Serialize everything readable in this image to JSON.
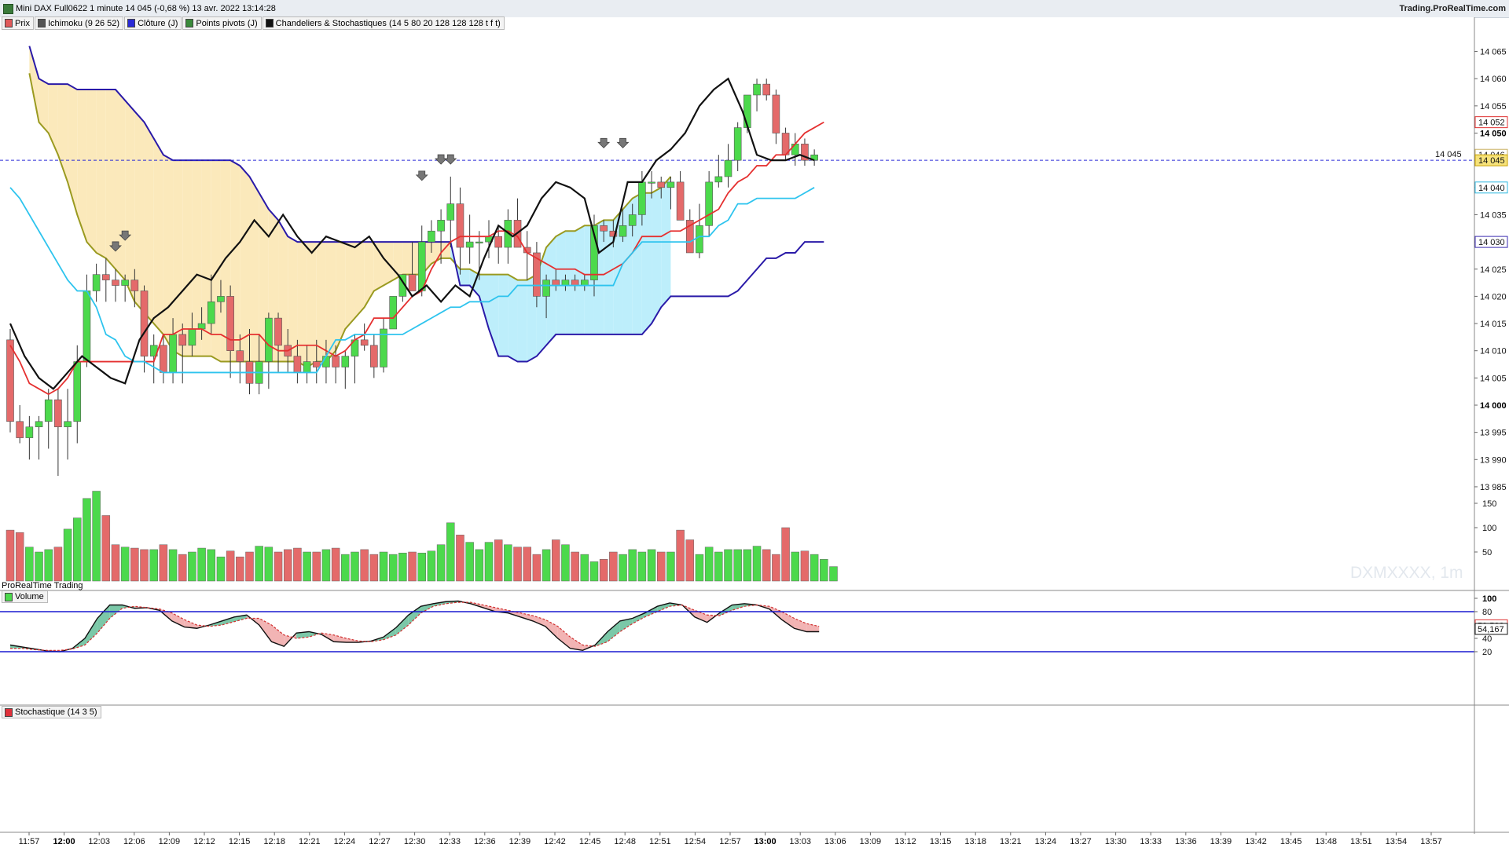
{
  "window": {
    "title": "Mini DAX Full0622 1 minute 14 045 (-0,68 %) 13 avr. 2022 13:14:28",
    "brand": "Trading.ProRealTime.com"
  },
  "legend": [
    {
      "label": "Prix",
      "color": "#e05a5a"
    },
    {
      "label": "Ichimoku (9 26 52)",
      "color": "#555555"
    },
    {
      "label": "Clôture (J)",
      "color": "#2a2ad6"
    },
    {
      "label": "Points pivots (J)",
      "color": "#3a8a3a"
    },
    {
      "label": "Chandeliers & Stochastiques (14 5 80 20 128 128 128 t f t)",
      "color": "#111111"
    }
  ],
  "panels": {
    "volume_label": "Volume",
    "stoch_label": "Stochastique (14 3 5)",
    "source_label": "ProRealTime Trading",
    "watermark": "DXMXXXX, 1m"
  },
  "price_axis": {
    "ticks": [
      "14 065",
      "14 060",
      "14 055",
      "14 050",
      "14 045",
      "14 040",
      "14 035",
      "14 030",
      "14 025",
      "14 020",
      "14 015",
      "14 010",
      "14 005",
      "14 000",
      "13 995",
      "13 990",
      "13 985"
    ],
    "bold_ticks": [
      "14 050",
      "14 000"
    ],
    "current_line_label": "14 045",
    "markers": [
      {
        "text": "14 052",
        "color": "#e03030"
      },
      {
        "text": "14 046",
        "color": "#c8b060"
      },
      {
        "text": "14 045",
        "color": "#c8a000"
      },
      {
        "text": "14 040",
        "color": "#2fb8e0"
      },
      {
        "text": "14 030",
        "color": "#3a2ab0"
      }
    ]
  },
  "volume_axis": {
    "ticks": [
      "150",
      "100",
      "50"
    ]
  },
  "stoch_axis": {
    "ticks": [
      "100",
      "80",
      "60",
      "40",
      "20"
    ],
    "markers": [
      {
        "text": "59,583",
        "color": "#e03030"
      },
      {
        "text": "54,167",
        "color": "#111111"
      }
    ]
  },
  "time_axis": [
    "11:57",
    "12:00",
    "12:03",
    "12:06",
    "12:09",
    "12:12",
    "12:15",
    "12:18",
    "12:21",
    "12:24",
    "12:27",
    "12:30",
    "12:33",
    "12:36",
    "12:39",
    "12:42",
    "12:45",
    "12:48",
    "12:51",
    "12:54",
    "12:57",
    "13:00",
    "13:03",
    "13:06",
    "13:09",
    "13:12",
    "13:15",
    "13:18",
    "13:21",
    "13:24",
    "13:27",
    "13:30",
    "13:33",
    "13:36",
    "13:39",
    "13:42",
    "13:45",
    "13:48",
    "13:51",
    "13:54",
    "13:57"
  ],
  "time_axis_bold": [
    "12:00",
    "13:00"
  ],
  "colors": {
    "up": "#4cd94c",
    "down": "#e46a6a",
    "tenkan": "#e53030",
    "kijun": "#2ec4ee",
    "spanA": "#9a9a20",
    "spanB": "#2a1aa8",
    "closeLine": "#111111",
    "cloudUp": "#fbe9bb",
    "cloudDown": "#bdeefb",
    "stochUp": "#7bc8a8",
    "stochDown": "#f2b4b4"
  },
  "chart_data": {
    "type": "candlestick",
    "candles": [
      [
        14012,
        14014,
        13995,
        13997
      ],
      [
        13997,
        14000,
        13993,
        13994
      ],
      [
        13994,
        13998,
        13990,
        13996
      ],
      [
        13996,
        13998,
        13990,
        13997
      ],
      [
        13997,
        14003,
        13992,
        14001
      ],
      [
        14001,
        14003,
        13987,
        13996
      ],
      [
        13996,
        14003,
        13990,
        13997
      ],
      [
        13997,
        14011,
        13993,
        14008
      ],
      [
        14008,
        14024,
        14007,
        14021
      ],
      [
        14021,
        14026,
        14019,
        14024
      ],
      [
        14024,
        14027,
        14019,
        14023
      ],
      [
        14023,
        14025,
        14019,
        14022
      ],
      [
        14022,
        14024,
        14019,
        14023
      ],
      [
        14023,
        14025,
        14018,
        14021
      ],
      [
        14021,
        14022,
        14006,
        14009
      ],
      [
        14009,
        14013,
        14004,
        14011
      ],
      [
        14011,
        14013,
        14004,
        14006
      ],
      [
        14006,
        14016,
        14004,
        14013
      ],
      [
        14013,
        14015,
        14004,
        14011
      ],
      [
        14011,
        14017,
        14009,
        14014
      ],
      [
        14014,
        14018,
        14012,
        14015
      ],
      [
        14015,
        14024,
        14013,
        14019
      ],
      [
        14019,
        14023,
        14017,
        14020
      ],
      [
        14020,
        14022,
        14005,
        14010
      ],
      [
        14010,
        14013,
        14004,
        14008
      ],
      [
        14008,
        14014,
        14002,
        14004
      ],
      [
        14004,
        14013,
        14002,
        14008
      ],
      [
        14008,
        14017,
        14003,
        14016
      ],
      [
        14016,
        14017,
        14006,
        14011
      ],
      [
        14011,
        14014,
        14006,
        14009
      ],
      [
        14009,
        14012,
        14004,
        14006
      ],
      [
        14006,
        14011,
        14004,
        14008
      ],
      [
        14008,
        14012,
        14004,
        14007
      ],
      [
        14007,
        14012,
        14004,
        14009
      ],
      [
        14009,
        14011,
        14004,
        14007
      ],
      [
        14007,
        14010,
        14003,
        14009
      ],
      [
        14009,
        14013,
        14004,
        14012
      ],
      [
        14012,
        14015,
        14010,
        14011
      ],
      [
        14011,
        14013,
        14005,
        14007
      ],
      [
        14007,
        14016,
        14006,
        14014
      ],
      [
        14014,
        14020,
        14014,
        14020
      ],
      [
        14020,
        14024,
        14019,
        14024
      ],
      [
        14024,
        14030,
        14022,
        14021
      ],
      [
        14021,
        14033,
        14020,
        14030
      ],
      [
        14030,
        14034,
        14028,
        14032
      ],
      [
        14032,
        14036,
        14026,
        14034
      ],
      [
        14034,
        14042,
        14029,
        14037
      ],
      [
        14037,
        14040,
        14024,
        14029
      ],
      [
        14029,
        14035,
        14026,
        14030
      ],
      [
        14030,
        14032,
        14023,
        14030
      ],
      [
        14030,
        14034,
        14027,
        14031
      ],
      [
        14031,
        14033,
        14026,
        14029
      ],
      [
        14029,
        14036,
        14026,
        14034
      ],
      [
        14034,
        14038,
        14031,
        14029
      ],
      [
        14029,
        14032,
        14023,
        14028
      ],
      [
        14028,
        14030,
        14018,
        14020
      ],
      [
        14020,
        14024,
        14016,
        14023
      ],
      [
        14023,
        14025,
        14021,
        14022
      ],
      [
        14022,
        14024,
        14021,
        14023
      ],
      [
        14023,
        14024,
        14021,
        14022
      ],
      [
        14022,
        14024,
        14021,
        14023
      ],
      [
        14023,
        14035,
        14020,
        14033
      ],
      [
        14033,
        14034,
        14030,
        14032
      ],
      [
        14032,
        14034,
        14029,
        14031
      ],
      [
        14031,
        14036,
        14030,
        14033
      ],
      [
        14033,
        14037,
        14031,
        14035
      ],
      [
        14035,
        14043,
        14033,
        14041
      ],
      [
        14041,
        14043,
        14038,
        14041
      ],
      [
        14041,
        14042,
        14038,
        14040
      ],
      [
        14040,
        14042,
        14036,
        14041
      ],
      [
        14041,
        14043,
        14035,
        14034
      ],
      [
        14034,
        14036,
        14030,
        14028
      ],
      [
        14028,
        14037,
        14027,
        14033
      ],
      [
        14033,
        14043,
        14031,
        14041
      ],
      [
        14041,
        14046,
        14040,
        14042
      ],
      [
        14042,
        14048,
        14040,
        14045
      ],
      [
        14045,
        14052,
        14043,
        14051
      ],
      [
        14051,
        14057,
        14050,
        14057
      ],
      [
        14057,
        14060,
        14054,
        14059
      ],
      [
        14059,
        14060,
        14056,
        14057
      ],
      [
        14057,
        14058,
        14048,
        14050
      ],
      [
        14050,
        14051,
        14045,
        14046
      ],
      [
        14046,
        14050,
        14044,
        14048
      ],
      [
        14048,
        14049,
        14044,
        14045
      ],
      [
        14045,
        14047,
        14044,
        14046
      ]
    ],
    "volume": [
      95,
      90,
      60,
      50,
      55,
      60,
      97,
      120,
      160,
      175,
      125,
      65,
      60,
      58,
      55,
      55,
      65,
      55,
      45,
      50,
      58,
      55,
      40,
      52,
      40,
      50,
      62,
      60,
      50,
      55,
      58,
      50,
      50,
      55,
      58,
      45,
      50,
      55,
      45,
      50,
      45,
      48,
      50,
      48,
      52,
      65,
      110,
      85,
      70,
      55,
      70,
      75,
      65,
      60,
      60,
      45,
      55,
      75,
      65,
      50,
      45,
      30,
      35,
      50,
      45,
      55,
      50,
      55,
      50,
      50,
      95,
      75,
      45,
      60,
      50,
      55,
      55,
      55,
      62,
      55,
      45,
      100,
      50,
      52,
      45,
      35,
      20
    ],
    "tenkan": [
      14011,
      14008,
      14004,
      14003,
      14002,
      14003,
      14005,
      14008,
      14008,
      14008,
      14008,
      14008,
      14008,
      14008,
      14008,
      14008,
      14013,
      14013,
      14014,
      14014,
      14014,
      14013,
      14013,
      14012,
      14012,
      14013,
      14013,
      14011,
      14010,
      14010,
      14011,
      14011,
      14011,
      14010,
      14009,
      14010,
      14012,
      14013,
      14016,
      14016,
      14016,
      14018,
      14020,
      14021,
      14025,
      14028,
      14030,
      14031,
      14031,
      14031,
      14031,
      14032,
      14032,
      14031,
      14028,
      14027,
      14026,
      14025,
      14025,
      14025,
      14024,
      14024,
      14024,
      14025,
      14026,
      14028,
      14031,
      14031,
      14031,
      14032,
      14032,
      14033,
      14034,
      14035,
      14036,
      14039,
      14041,
      14042,
      14044,
      14044,
      14046,
      14046,
      14048,
      14050,
      14051,
      14052
    ],
    "kijun": [
      14040,
      14038,
      14035,
      14032,
      14029,
      14026,
      14023,
      14021,
      14021,
      14018,
      14013,
      14012,
      14009,
      14008,
      14008,
      14007,
      14006,
      14006,
      14006,
      14006,
      14006,
      14006,
      14006,
      14006,
      14006,
      14006,
      14006,
      14006,
      14006,
      14006,
      14006,
      14006,
      14006,
      14009,
      14012,
      14012,
      14013,
      14013,
      14013,
      14013,
      14013,
      14013,
      14014,
      14015,
      14016,
      14017,
      14018,
      14018,
      14019,
      14019,
      14019,
      14020,
      14020,
      14022,
      14022,
      14022,
      14022,
      14022,
      14022,
      14022,
      14022,
      14022,
      14022,
      14022,
      14026,
      14028,
      14030,
      14030,
      14030,
      14030,
      14030,
      14030,
      14031,
      14031,
      14033,
      14034,
      14037,
      14037,
      14038,
      14038,
      14038,
      14038,
      14038,
      14039,
      14040
    ],
    "close_line": [
      14015,
      14009,
      14005,
      14003,
      14006,
      14009,
      14007,
      14005,
      14004,
      14012,
      14016,
      14018,
      14021,
      14024,
      14023,
      14027,
      14030,
      14034,
      14031,
      14035,
      14031,
      14028,
      14031,
      14030,
      14029,
      14031,
      14027,
      14024,
      14020,
      14022,
      14019,
      14022,
      14020,
      14027,
      14033,
      14031,
      14033,
      14038,
      14041,
      14040,
      14038,
      14028,
      14030,
      14041,
      14041,
      14045,
      14047,
      14050,
      14055,
      14058,
      14060,
      14054,
      14046,
      14045,
      14045,
      14046,
      14045
    ],
    "span_a": [
      14061,
      14052,
      14050,
      14046,
      14041,
      14035,
      14030,
      14028,
      14027,
      14025,
      14023,
      14019,
      14017,
      14015,
      14013,
      14010,
      14009,
      14009,
      14009,
      14009,
      14008,
      14008,
      14008,
      14008,
      14008,
      14008,
      14008,
      14008,
      14008,
      14007,
      14008,
      14008,
      14010,
      14014,
      14016,
      14018,
      14021,
      14022,
      14023,
      14024,
      14024,
      14024,
      14026,
      14027,
      14027,
      14025,
      14025,
      14024,
      14024,
      14024,
      14024,
      14023,
      14023,
      14024,
      14029,
      14031,
      14032,
      14032,
      14033,
      14033,
      14034,
      14034,
      14036,
      14038,
      14039,
      14039,
      14040,
      14042
    ],
    "span_b": [
      14066,
      14060,
      14059,
      14059,
      14059,
      14058,
      14058,
      14058,
      14058,
      14058,
      14056,
      14054,
      14052,
      14049,
      14046,
      14045,
      14045,
      14045,
      14045,
      14045,
      14045,
      14045,
      14044,
      14042,
      14039,
      14036,
      14034,
      14031,
      14030,
      14030,
      14030,
      14030,
      14030,
      14030,
      14030,
      14030,
      14030,
      14030,
      14030,
      14030,
      14030,
      14030,
      14030,
      14030,
      14030,
      14022,
      14022,
      14020,
      14014,
      14009,
      14009,
      14008,
      14008,
      14009,
      14011,
      14013,
      14013,
      14013,
      14013,
      14013,
      14013,
      14013,
      14013,
      14013,
      14013,
      14015,
      14018,
      14020,
      14020,
      14020,
      14020,
      14020,
      14020,
      14020,
      14021,
      14023,
      14025,
      14027,
      14027,
      14028,
      14028,
      14030,
      14030,
      14030
    ],
    "stoch_k": [
      30,
      27,
      24,
      21,
      20,
      25,
      40,
      70,
      90,
      90,
      85,
      86,
      82,
      66,
      57,
      55,
      60,
      66,
      72,
      75,
      60,
      35,
      28,
      48,
      50,
      46,
      35,
      34,
      34,
      36,
      42,
      56,
      75,
      88,
      92,
      95,
      96,
      92,
      86,
      80,
      78,
      72,
      66,
      58,
      40,
      25,
      22,
      30,
      50,
      66,
      70,
      78,
      88,
      93,
      90,
      72,
      64,
      78,
      90,
      92,
      90,
      84,
      68,
      55,
      50,
      50
    ],
    "stoch_d": [
      25,
      25,
      23,
      22,
      22,
      24,
      30,
      48,
      70,
      85,
      88,
      86,
      84,
      78,
      68,
      60,
      58,
      60,
      65,
      70,
      70,
      60,
      45,
      40,
      42,
      48,
      45,
      40,
      36,
      35,
      38,
      45,
      60,
      78,
      88,
      92,
      94,
      94,
      90,
      86,
      82,
      78,
      74,
      68,
      58,
      42,
      30,
      28,
      35,
      50,
      62,
      72,
      80,
      88,
      90,
      82,
      75,
      74,
      82,
      88,
      90,
      88,
      80,
      70,
      62,
      58
    ]
  }
}
